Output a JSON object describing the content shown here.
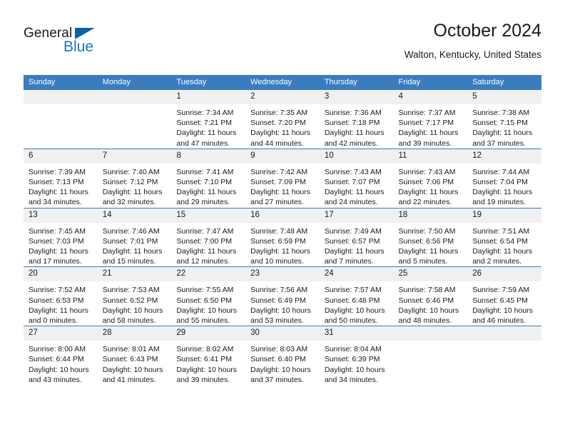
{
  "brand": {
    "name_part1": "General",
    "name_part2": "Blue",
    "accent_color": "#1b75bb",
    "header_color": "#3b7cbf"
  },
  "header": {
    "title": "October 2024",
    "subtitle": "Walton, Kentucky, United States"
  },
  "calendar": {
    "weekday_headers": [
      "Sunday",
      "Monday",
      "Tuesday",
      "Wednesday",
      "Thursday",
      "Friday",
      "Saturday"
    ],
    "labels": {
      "sunrise": "Sunrise:",
      "sunset": "Sunset:",
      "daylight": "Daylight:"
    },
    "weeks": [
      [
        {
          "day": "",
          "blank": true,
          "sunrise": "",
          "sunset": "",
          "daylight_line1": "",
          "daylight_line2": ""
        },
        {
          "day": "",
          "blank": true,
          "sunrise": "",
          "sunset": "",
          "daylight_line1": "",
          "daylight_line2": ""
        },
        {
          "day": "1",
          "sunrise": "Sunrise: 7:34 AM",
          "sunset": "Sunset: 7:21 PM",
          "daylight_line1": "Daylight: 11 hours",
          "daylight_line2": "and 47 minutes."
        },
        {
          "day": "2",
          "sunrise": "Sunrise: 7:35 AM",
          "sunset": "Sunset: 7:20 PM",
          "daylight_line1": "Daylight: 11 hours",
          "daylight_line2": "and 44 minutes."
        },
        {
          "day": "3",
          "sunrise": "Sunrise: 7:36 AM",
          "sunset": "Sunset: 7:18 PM",
          "daylight_line1": "Daylight: 11 hours",
          "daylight_line2": "and 42 minutes."
        },
        {
          "day": "4",
          "sunrise": "Sunrise: 7:37 AM",
          "sunset": "Sunset: 7:17 PM",
          "daylight_line1": "Daylight: 11 hours",
          "daylight_line2": "and 39 minutes."
        },
        {
          "day": "5",
          "sunrise": "Sunrise: 7:38 AM",
          "sunset": "Sunset: 7:15 PM",
          "daylight_line1": "Daylight: 11 hours",
          "daylight_line2": "and 37 minutes."
        }
      ],
      [
        {
          "day": "6",
          "sunrise": "Sunrise: 7:39 AM",
          "sunset": "Sunset: 7:13 PM",
          "daylight_line1": "Daylight: 11 hours",
          "daylight_line2": "and 34 minutes."
        },
        {
          "day": "7",
          "sunrise": "Sunrise: 7:40 AM",
          "sunset": "Sunset: 7:12 PM",
          "daylight_line1": "Daylight: 11 hours",
          "daylight_line2": "and 32 minutes."
        },
        {
          "day": "8",
          "sunrise": "Sunrise: 7:41 AM",
          "sunset": "Sunset: 7:10 PM",
          "daylight_line1": "Daylight: 11 hours",
          "daylight_line2": "and 29 minutes."
        },
        {
          "day": "9",
          "sunrise": "Sunrise: 7:42 AM",
          "sunset": "Sunset: 7:09 PM",
          "daylight_line1": "Daylight: 11 hours",
          "daylight_line2": "and 27 minutes."
        },
        {
          "day": "10",
          "sunrise": "Sunrise: 7:43 AM",
          "sunset": "Sunset: 7:07 PM",
          "daylight_line1": "Daylight: 11 hours",
          "daylight_line2": "and 24 minutes."
        },
        {
          "day": "11",
          "sunrise": "Sunrise: 7:43 AM",
          "sunset": "Sunset: 7:06 PM",
          "daylight_line1": "Daylight: 11 hours",
          "daylight_line2": "and 22 minutes."
        },
        {
          "day": "12",
          "sunrise": "Sunrise: 7:44 AM",
          "sunset": "Sunset: 7:04 PM",
          "daylight_line1": "Daylight: 11 hours",
          "daylight_line2": "and 19 minutes."
        }
      ],
      [
        {
          "day": "13",
          "sunrise": "Sunrise: 7:45 AM",
          "sunset": "Sunset: 7:03 PM",
          "daylight_line1": "Daylight: 11 hours",
          "daylight_line2": "and 17 minutes."
        },
        {
          "day": "14",
          "sunrise": "Sunrise: 7:46 AM",
          "sunset": "Sunset: 7:01 PM",
          "daylight_line1": "Daylight: 11 hours",
          "daylight_line2": "and 15 minutes."
        },
        {
          "day": "15",
          "sunrise": "Sunrise: 7:47 AM",
          "sunset": "Sunset: 7:00 PM",
          "daylight_line1": "Daylight: 11 hours",
          "daylight_line2": "and 12 minutes."
        },
        {
          "day": "16",
          "sunrise": "Sunrise: 7:48 AM",
          "sunset": "Sunset: 6:59 PM",
          "daylight_line1": "Daylight: 11 hours",
          "daylight_line2": "and 10 minutes."
        },
        {
          "day": "17",
          "sunrise": "Sunrise: 7:49 AM",
          "sunset": "Sunset: 6:57 PM",
          "daylight_line1": "Daylight: 11 hours",
          "daylight_line2": "and 7 minutes."
        },
        {
          "day": "18",
          "sunrise": "Sunrise: 7:50 AM",
          "sunset": "Sunset: 6:56 PM",
          "daylight_line1": "Daylight: 11 hours",
          "daylight_line2": "and 5 minutes."
        },
        {
          "day": "19",
          "sunrise": "Sunrise: 7:51 AM",
          "sunset": "Sunset: 6:54 PM",
          "daylight_line1": "Daylight: 11 hours",
          "daylight_line2": "and 2 minutes."
        }
      ],
      [
        {
          "day": "20",
          "sunrise": "Sunrise: 7:52 AM",
          "sunset": "Sunset: 6:53 PM",
          "daylight_line1": "Daylight: 11 hours",
          "daylight_line2": "and 0 minutes."
        },
        {
          "day": "21",
          "sunrise": "Sunrise: 7:53 AM",
          "sunset": "Sunset: 6:52 PM",
          "daylight_line1": "Daylight: 10 hours",
          "daylight_line2": "and 58 minutes."
        },
        {
          "day": "22",
          "sunrise": "Sunrise: 7:55 AM",
          "sunset": "Sunset: 6:50 PM",
          "daylight_line1": "Daylight: 10 hours",
          "daylight_line2": "and 55 minutes."
        },
        {
          "day": "23",
          "sunrise": "Sunrise: 7:56 AM",
          "sunset": "Sunset: 6:49 PM",
          "daylight_line1": "Daylight: 10 hours",
          "daylight_line2": "and 53 minutes."
        },
        {
          "day": "24",
          "sunrise": "Sunrise: 7:57 AM",
          "sunset": "Sunset: 6:48 PM",
          "daylight_line1": "Daylight: 10 hours",
          "daylight_line2": "and 50 minutes."
        },
        {
          "day": "25",
          "sunrise": "Sunrise: 7:58 AM",
          "sunset": "Sunset: 6:46 PM",
          "daylight_line1": "Daylight: 10 hours",
          "daylight_line2": "and 48 minutes."
        },
        {
          "day": "26",
          "sunrise": "Sunrise: 7:59 AM",
          "sunset": "Sunset: 6:45 PM",
          "daylight_line1": "Daylight: 10 hours",
          "daylight_line2": "and 46 minutes."
        }
      ],
      [
        {
          "day": "27",
          "sunrise": "Sunrise: 8:00 AM",
          "sunset": "Sunset: 6:44 PM",
          "daylight_line1": "Daylight: 10 hours",
          "daylight_line2": "and 43 minutes."
        },
        {
          "day": "28",
          "sunrise": "Sunrise: 8:01 AM",
          "sunset": "Sunset: 6:43 PM",
          "daylight_line1": "Daylight: 10 hours",
          "daylight_line2": "and 41 minutes."
        },
        {
          "day": "29",
          "sunrise": "Sunrise: 8:02 AM",
          "sunset": "Sunset: 6:41 PM",
          "daylight_line1": "Daylight: 10 hours",
          "daylight_line2": "and 39 minutes."
        },
        {
          "day": "30",
          "sunrise": "Sunrise: 8:03 AM",
          "sunset": "Sunset: 6:40 PM",
          "daylight_line1": "Daylight: 10 hours",
          "daylight_line2": "and 37 minutes."
        },
        {
          "day": "31",
          "sunrise": "Sunrise: 8:04 AM",
          "sunset": "Sunset: 6:39 PM",
          "daylight_line1": "Daylight: 10 hours",
          "daylight_line2": "and 34 minutes."
        },
        {
          "day": "",
          "blank": true,
          "sunrise": "",
          "sunset": "",
          "daylight_line1": "",
          "daylight_line2": ""
        },
        {
          "day": "",
          "blank": true,
          "sunrise": "",
          "sunset": "",
          "daylight_line1": "",
          "daylight_line2": ""
        }
      ]
    ]
  }
}
